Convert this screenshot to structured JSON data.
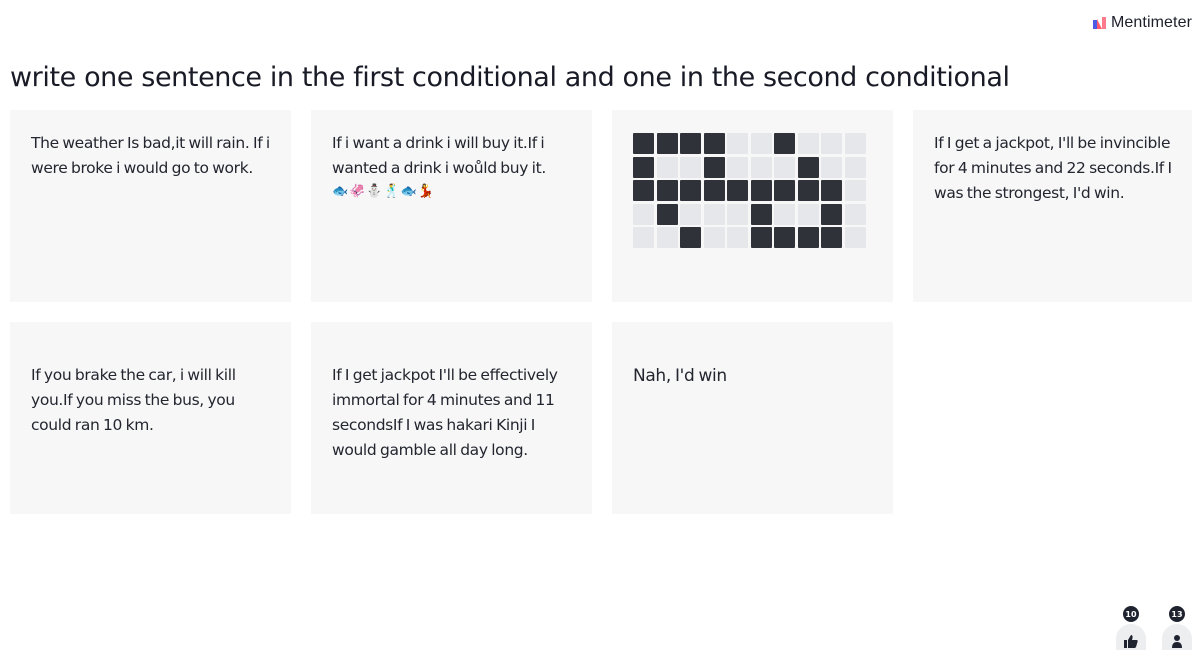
{
  "brand": {
    "name": "Mentimeter",
    "logo_icon": "mentimeter-logo-icon"
  },
  "question": "write one sentence in the first conditional and one in the second conditional",
  "responses": [
    {
      "text": "The weather Is bad,it will rain. If i were broke i would go to work."
    },
    {
      "text": "If i want a drink i will buy it.If i wanted a drink i woůld buy it.",
      "emoji": "🐟🦑⛄🕺🐟💃"
    },
    {
      "type": "pixel-grid",
      "rows": [
        [
          1,
          1,
          1,
          1,
          0,
          0,
          1,
          0,
          0,
          0
        ],
        [
          1,
          0,
          0,
          1,
          0,
          0,
          0,
          1,
          0,
          0
        ],
        [
          1,
          1,
          1,
          1,
          1,
          1,
          1,
          1,
          1,
          0
        ],
        [
          0,
          1,
          0,
          0,
          0,
          1,
          0,
          0,
          1,
          0
        ],
        [
          0,
          0,
          1,
          0,
          0,
          1,
          1,
          1,
          1,
          0
        ]
      ]
    },
    {
      "text": "If I get a jackpot, I'll be invincible for 4 minutes and 22 seconds.If I was the strongest, I'd win."
    },
    {
      "text": "If you brake the car, i will kill you.If you miss the bus, you could ran 10 km."
    },
    {
      "text": "If I get jackpot I'll be effectively immortal for 4 minutes and 11 secondsIf I was hakari Kinji I would gamble all day long."
    },
    {
      "text": "Nah, I'd win"
    }
  ],
  "reactions": {
    "likes": {
      "count": "10",
      "icon": "thumbs-up-icon"
    },
    "participants": {
      "count": "13",
      "icon": "person-icon"
    }
  },
  "colors": {
    "card_bg": "#f7f7f8",
    "text": "#23262f",
    "grid_on": "#2f3339",
    "grid_off": "#e6e7ea"
  }
}
